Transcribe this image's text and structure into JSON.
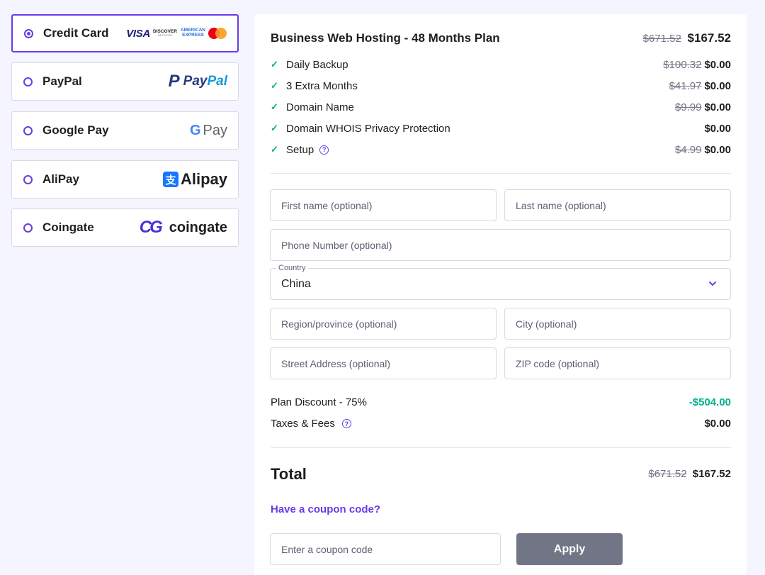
{
  "payment_methods": [
    {
      "label": "Credit Card",
      "selected": true
    },
    {
      "label": "PayPal",
      "selected": false
    },
    {
      "label": "Google Pay",
      "selected": false
    },
    {
      "label": "AliPay",
      "selected": false
    },
    {
      "label": "Coingate",
      "selected": false
    }
  ],
  "logos": {
    "visa": "VISA",
    "discover": "DISCOVER",
    "discover_sub": "NETWORK",
    "amex_line1": "AMERICAN",
    "amex_line2": "EXPRESS",
    "paypal_mark": "P",
    "paypal_pay": "Pay",
    "paypal_pal": "Pal",
    "gpay_g": "G",
    "gpay_text": "Pay",
    "alipay_mark": "支",
    "alipay_text": "Alipay",
    "coingate_mark": "CG",
    "coingate_text": "coingate"
  },
  "order": {
    "plan_title": "Business Web Hosting - 48 Months Plan",
    "plan_old_price": "$671.52",
    "plan_price": "$167.52",
    "features": [
      {
        "label": "Daily Backup",
        "old_price": "$100.32",
        "price": "$0.00",
        "help": false
      },
      {
        "label": "3 Extra Months",
        "old_price": "$41.97",
        "price": "$0.00",
        "help": false
      },
      {
        "label": "Domain Name",
        "old_price": "$9.99",
        "price": "$0.00",
        "help": false
      },
      {
        "label": "Domain WHOIS Privacy Protection",
        "old_price": "",
        "price": "$0.00",
        "help": false
      },
      {
        "label": "Setup",
        "old_price": "$4.99",
        "price": "$0.00",
        "help": true
      }
    ]
  },
  "form": {
    "first_name_placeholder": "First name (optional)",
    "last_name_placeholder": "Last name (optional)",
    "phone_placeholder": "Phone Number (optional)",
    "country_label": "Country",
    "country_value": "China",
    "region_placeholder": "Region/province (optional)",
    "city_placeholder": "City (optional)",
    "street_placeholder": "Street Address (optional)",
    "zip_placeholder": "ZIP code (optional)"
  },
  "summary": {
    "discount_label": "Plan Discount - 75%",
    "discount_value": "-$504.00",
    "taxes_label": "Taxes & Fees",
    "taxes_value": "$0.00",
    "total_label": "Total",
    "total_old_price": "$671.52",
    "total_price": "$167.52"
  },
  "coupon": {
    "link_text": "Have a coupon code?",
    "placeholder": "Enter a coupon code",
    "apply_label": "Apply"
  },
  "colors": {
    "accent": "#673de6",
    "success": "#00b090",
    "button_disabled": "#727586",
    "page_bg": "#f4f5ff"
  },
  "icons": {
    "check": "✓",
    "help": "?"
  }
}
